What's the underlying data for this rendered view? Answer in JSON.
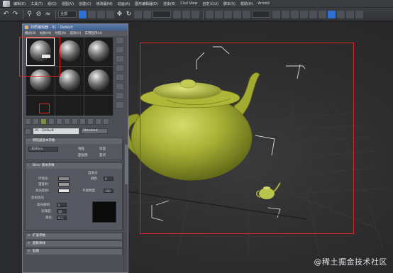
{
  "menubar": {
    "items": [
      "编辑(E)",
      "工具(T)",
      "组(G)",
      "视图(V)",
      "创建(C)",
      "修改器(M)",
      "动画(A)",
      "图形编辑器(D)",
      "渲染(R)",
      "Civil View",
      "自定义(U)",
      "脚本(S)",
      "帮助(H)",
      "Arnold"
    ]
  },
  "toolbar": {
    "filter_dropdown": "全部"
  },
  "material_editor": {
    "title": "材质编辑器 - 01 - Default",
    "menus": [
      "模式(D)",
      "材质(M)",
      "导航(N)",
      "选项(O)",
      "实用程序(U)"
    ],
    "material_name": "01 - Default",
    "type_button": "Standard",
    "rollouts": {
      "shader_basic": "明暗器基本参数",
      "blinn_basic": "Blinn 基本参数",
      "extended": "扩展参数",
      "supersampling": "超级采样",
      "maps": "贴图"
    },
    "shader": {
      "type": "(B)Blinn",
      "wire": "线框",
      "two_sided": "双面",
      "face_map": "面贴图",
      "faceted": "面状"
    },
    "blinn": {
      "ambient": "环境光:",
      "diffuse": "漫反射:",
      "specular": "高光反射:",
      "self_illum": "自发光",
      "color": "颜色",
      "color_value": "0",
      "opacity": "不透明度:",
      "opacity_value": "100",
      "specular_highlights": "反射高光",
      "specular_level": "高光级别:",
      "specular_level_value": "0",
      "glossiness": "光泽度:",
      "glossiness_value": "10",
      "soften": "柔化:",
      "soften_value": "0.1"
    }
  },
  "watermark": "@稀土掘金技术社区"
}
